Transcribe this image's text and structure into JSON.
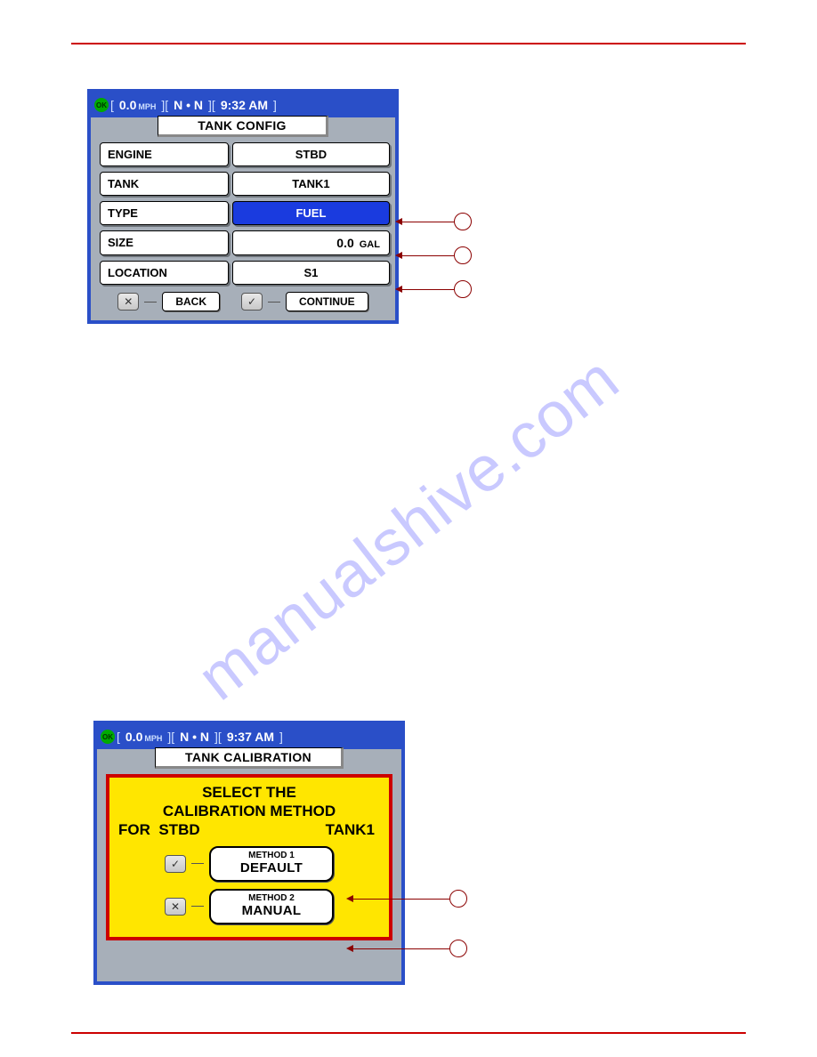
{
  "watermark": "manualshive.com",
  "screen1": {
    "status": {
      "speed": "0.0",
      "speed_unit": "MPH",
      "heading": "N  •  N",
      "time": "9:32 AM",
      "ok": "OK"
    },
    "title": "TANK CONFIG",
    "rows": {
      "engine": {
        "label": "ENGINE",
        "value": "STBD"
      },
      "tank": {
        "label": "TANK",
        "value": "TANK1"
      },
      "type": {
        "label": "TYPE",
        "value": "FUEL"
      },
      "size": {
        "label": "SIZE",
        "value": "0.0",
        "unit": "GAL"
      },
      "location": {
        "label": "LOCATION",
        "value": "S1"
      }
    },
    "footer": {
      "back_icon": "✕",
      "back": "BACK",
      "continue_icon": "✓",
      "continue": "CONTINUE"
    }
  },
  "screen2": {
    "status": {
      "speed": "0.0",
      "speed_unit": "MPH",
      "heading": "N  •  N",
      "time": "9:37 AM",
      "ok": "OK"
    },
    "title": "TANK CALIBRATION",
    "heading_line1": "SELECT THE",
    "heading_line2": "CALIBRATION METHOD",
    "for_label": "FOR",
    "for_engine": "STBD",
    "for_tank": "TANK1",
    "methods": [
      {
        "icon": "✓",
        "top": "METHOD 1",
        "name": "DEFAULT"
      },
      {
        "icon": "✕",
        "top": "METHOD 2",
        "name": "MANUAL"
      }
    ]
  }
}
